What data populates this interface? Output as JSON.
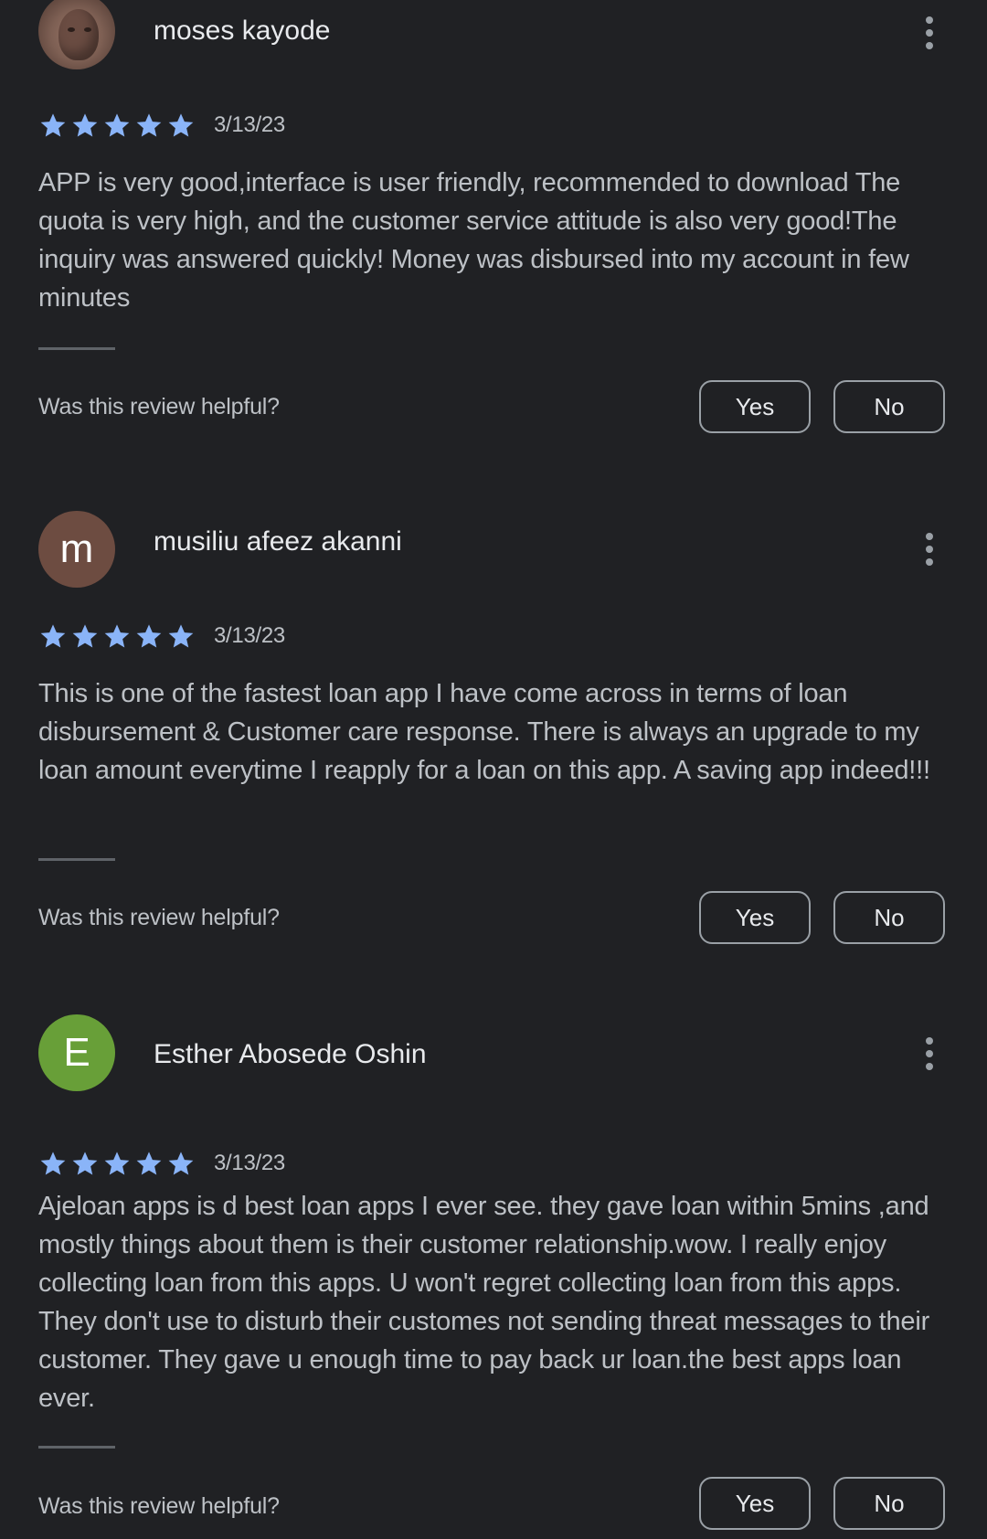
{
  "reviews": [
    {
      "reviewer_name": "moses kayode",
      "avatar": {
        "type": "photo",
        "initial": "",
        "color": "#7d5f53"
      },
      "rating": 5,
      "max_rating": 5,
      "date": "3/13/23",
      "text": "APP is very good,interface is user friendly, recommended to download The quota is very high, and the customer service attitude is also very good!The inquiry was answered quickly! Money was disbursed into my account in few minutes",
      "helpful_prompt": "Was this review helpful?",
      "yes_label": "Yes",
      "no_label": "No"
    },
    {
      "reviewer_name": "musiliu afeez akanni",
      "avatar": {
        "type": "initial",
        "initial": "m",
        "color": "#6d4c41"
      },
      "rating": 5,
      "max_rating": 5,
      "date": "3/13/23",
      "text": "This is one of the fastest loan app I have come across in terms of loan disbursement & Customer care response. There is always an upgrade to my loan amount everytime I reapply for a loan on this app. A saving app indeed!!!",
      "helpful_prompt": "Was this review helpful?",
      "yes_label": "Yes",
      "no_label": "No"
    },
    {
      "reviewer_name": "Esther Abosede Oshin",
      "avatar": {
        "type": "initial",
        "initial": "E",
        "color": "#689f38"
      },
      "rating": 5,
      "max_rating": 5,
      "date": "3/13/23",
      "text": "Ajeloan apps is d best loan apps I ever see. they gave loan within 5mins ,and mostly things about them is their customer relationship.wow. I really enjoy collecting loan from this apps. U won't regret collecting loan from this apps. They don't use to disturb their customes not sending threat messages to their customer. They gave u enough time to pay back ur loan.the best apps loan ever.",
      "helpful_prompt": "Was this review helpful?",
      "yes_label": "Yes",
      "no_label": "No"
    }
  ],
  "icons": {
    "star": "star-icon",
    "more": "more-vert-icon"
  },
  "colors": {
    "background": "#202124",
    "star_filled": "#8ab4f8",
    "text_primary": "#e8eaed",
    "text_secondary": "#bdc1c6",
    "outline": "#9aa0a6"
  }
}
